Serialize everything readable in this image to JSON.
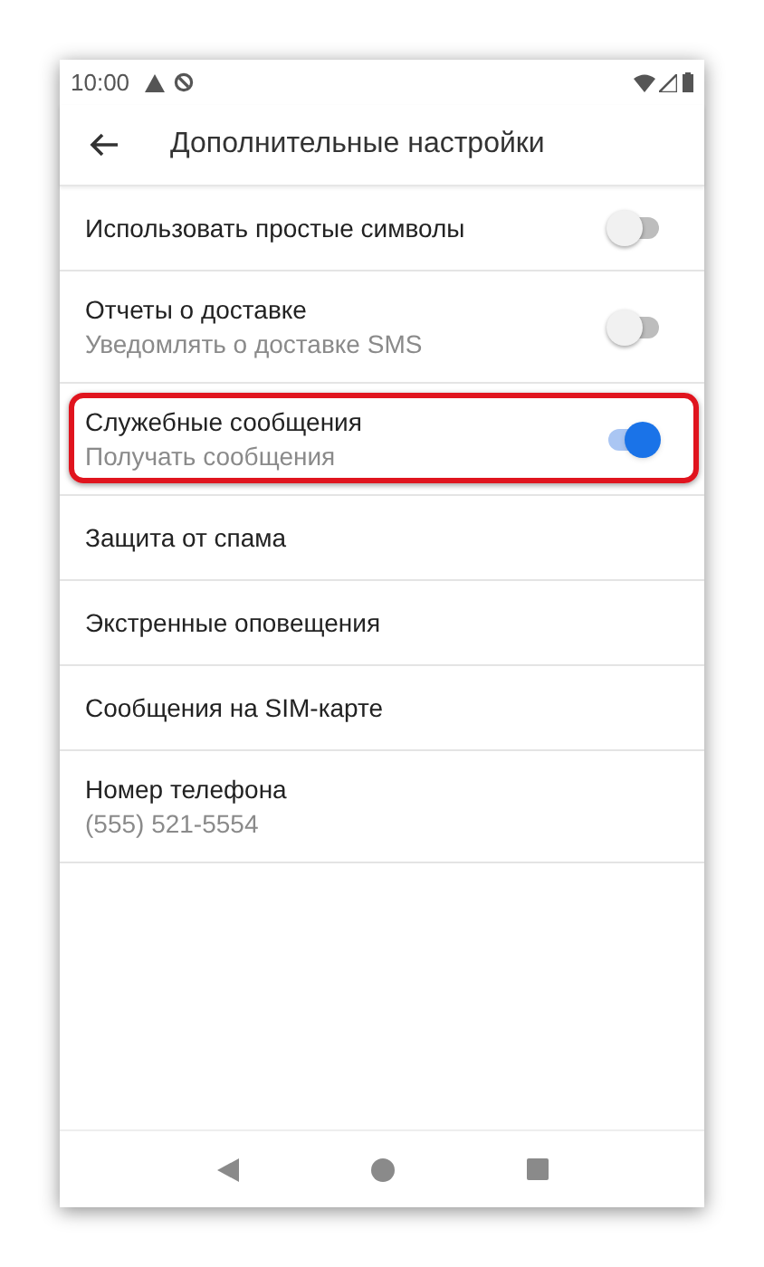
{
  "status_bar": {
    "time": "10:00"
  },
  "toolbar": {
    "title": "Дополнительные настройки"
  },
  "settings": [
    {
      "kind": "toggle",
      "title": "Использовать простые символы",
      "on": false,
      "highlighted": false
    },
    {
      "kind": "toggle",
      "title": "Отчеты о доставке",
      "subtitle": "Уведомлять о доставке SMS",
      "on": false,
      "highlighted": false
    },
    {
      "kind": "toggle",
      "title": "Служебные сообщения",
      "subtitle": "Получать сообщения",
      "on": true,
      "highlighted": true
    },
    {
      "kind": "link",
      "title": "Защита от спама"
    },
    {
      "kind": "link",
      "title": "Экстренные оповещения"
    },
    {
      "kind": "link",
      "title": "Сообщения на SIM-карте"
    },
    {
      "kind": "link",
      "title": "Номер телефона",
      "subtitle": "(555) 521-5554"
    }
  ]
}
